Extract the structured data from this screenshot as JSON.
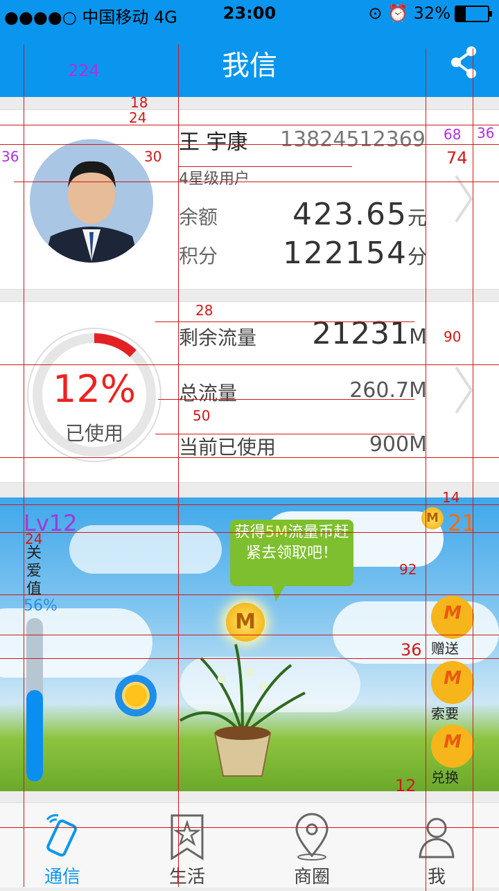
{
  "status_bar": {
    "carrier": "●●●●○ 中国移动  4G",
    "time": "23:00",
    "battery": "32%"
  },
  "nav": {
    "title": "我信",
    "share_icon": "share-icon"
  },
  "profile": {
    "name": "王 宇康",
    "phone": "13824512369",
    "level": "4星级用户",
    "balance_label": "余额",
    "balance_value": "423.65",
    "balance_unit": "元",
    "points_label": "积分",
    "points_value": "122154",
    "points_unit": "分"
  },
  "traffic": {
    "percent_text": "12%",
    "percent": 0.12,
    "used_caption": "已使用",
    "remaining_label": "剩余流量",
    "remaining_value": "21231",
    "remaining_unit": "M",
    "total_label": "总流量",
    "total_value": "260.7M",
    "current_label": "当前已使用",
    "current_value": "900M"
  },
  "garden": {
    "level": "Lv12",
    "care_label": "关爱值",
    "care_percent_text": "56%",
    "care_fraction": 0.56,
    "bubble_pre": "获得",
    "bubble_hl": "5M",
    "bubble_post": "流量币赶紧去领取吧！",
    "coin_count": "21",
    "coin_letter": "M",
    "actions": [
      {
        "label": "赠送",
        "letter": "M"
      },
      {
        "label": "索要",
        "letter": "M"
      },
      {
        "label": "兑换",
        "letter": "M"
      }
    ]
  },
  "tabs": [
    {
      "label": "通信",
      "icon": "phone-icon",
      "active": true
    },
    {
      "label": "生活",
      "icon": "star-bookmark-icon",
      "active": false
    },
    {
      "label": "商圈",
      "icon": "location-pin-icon",
      "active": false
    },
    {
      "label": "我",
      "icon": "user-icon",
      "active": false
    }
  ],
  "annotations": {
    "a224": "224",
    "a18": "18",
    "a24": "24",
    "a36": "36",
    "a30": "30",
    "a68": "68",
    "a36b": "36",
    "a74": "74",
    "a28": "28",
    "a90": "90",
    "a50": "50",
    "a14": "14",
    "a24b": "24",
    "a92": "92",
    "a36c": "36",
    "a12": "12"
  },
  "colors": {
    "primary": "#0a96ee",
    "accent_red": "#e22222",
    "annotation": "#d01818",
    "orange": "#ff6a00"
  }
}
